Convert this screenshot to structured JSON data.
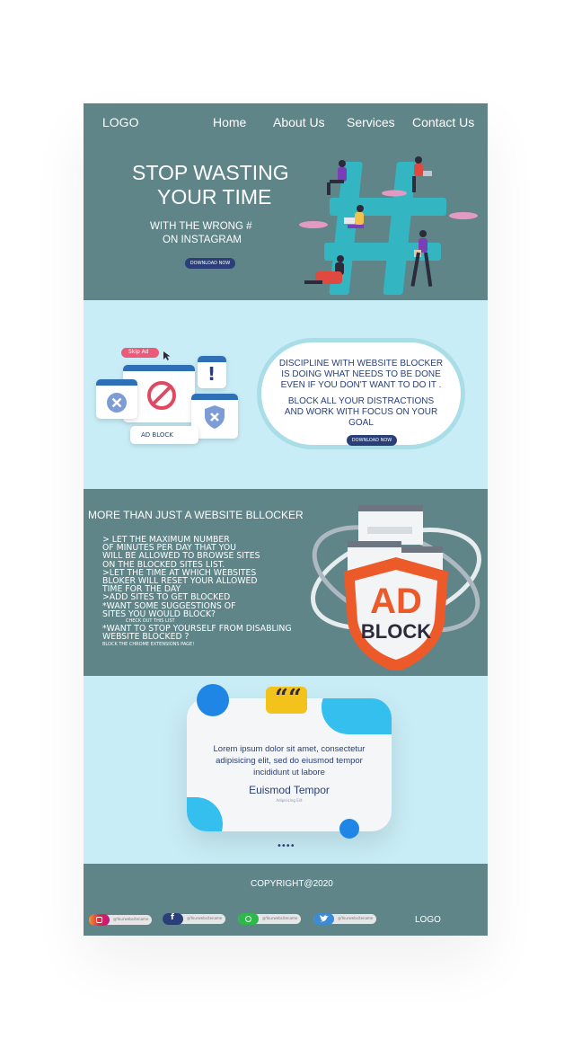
{
  "header": {
    "logo": "LOGO",
    "nav": [
      "Home",
      "About Us",
      "Services",
      "Contact Us"
    ]
  },
  "hero": {
    "title_line1": "STOP WASTING",
    "title_line2": "YOUR TIME",
    "subtitle_line1": "WITH THE WRONG #",
    "subtitle_line2": "ON INSTAGRAM",
    "button": "DOWNLOAD NOW"
  },
  "discipline": {
    "skip_ad": "Skip Ad",
    "ad_block_label": "AD BLOCK",
    "line1": "DISCIPLINE WITH WEBSITE BLOCKER",
    "line2": "IS DOING WHAT NEEDS TO BE DONE",
    "line3": "EVEN IF YOU DON'T WANT TO DO IT .",
    "line4": "BLOCK ALL YOUR DISTRACTIONS",
    "line5": "AND WORK WITH FOCUS ON YOUR",
    "line6": "GOAL",
    "button": "DOWNLOAD NOW"
  },
  "features": {
    "title": "MORE THAN JUST A WEBSITE BLLOCKER",
    "lines": [
      " > LET THE MAXIMUM NUMBER",
      "OF MINUTES PER DAY THAT YOU",
      "WILL BE ALLOWED TO BROWSE SITES",
      "ON THE BLOCKED SITES LIST.",
      ">LET THE TIME AT WHICH WEBSITES",
      "BLOKER WILL RESET YOUR ALLOWED",
      "TIME FOR THE DAY",
      ">ADD SITES TO GET BLOCKED",
      "*WANT SOME SUGGESTIONS OF",
      "SITES YOU WOULD BLOCK?"
    ],
    "check_out": "CHECK OUT THIS LIST",
    "lines2": [
      "*WANT TO STOP YOURSELF FROM DISABLING",
      "WEBSITE BLOCKED ?"
    ],
    "small": "BLOCK THE CHROME EXTENSIONS PAGE!",
    "shield_top": "AD",
    "shield_bottom": "BLOCK"
  },
  "testimonial": {
    "quote_mark": "““",
    "text_line1": "Lorem ipsum dolor sit amet, consectetur",
    "text_line2": "adipisicing elit, sed do eiusmod tempor",
    "text_line3": "incididunt ut labore",
    "name": "Euismod Tempor",
    "role": "Adipisicing Elit",
    "dots": "••••"
  },
  "footer": {
    "copyright": "COPYRIGHT@2020",
    "logo": "LOGO",
    "socials": [
      {
        "name": "instagram",
        "handle": "@Yourwebsitename",
        "color": "#c13584"
      },
      {
        "name": "facebook",
        "handle": "@Yourwebsitename",
        "color": "#2a3f77"
      },
      {
        "name": "whatsapp",
        "handle": "@Yourwebsitename",
        "color": "#2fb84a"
      },
      {
        "name": "twitter",
        "handle": "@Yourwebsitename",
        "color": "#3d8ad6"
      }
    ]
  },
  "colors": {
    "teal_dark": "#5f8589",
    "light_blue": "#c9edf6",
    "navy": "#2a3f77",
    "shield_orange": "#ec5a2a",
    "hashtag": "#33b5c2"
  }
}
